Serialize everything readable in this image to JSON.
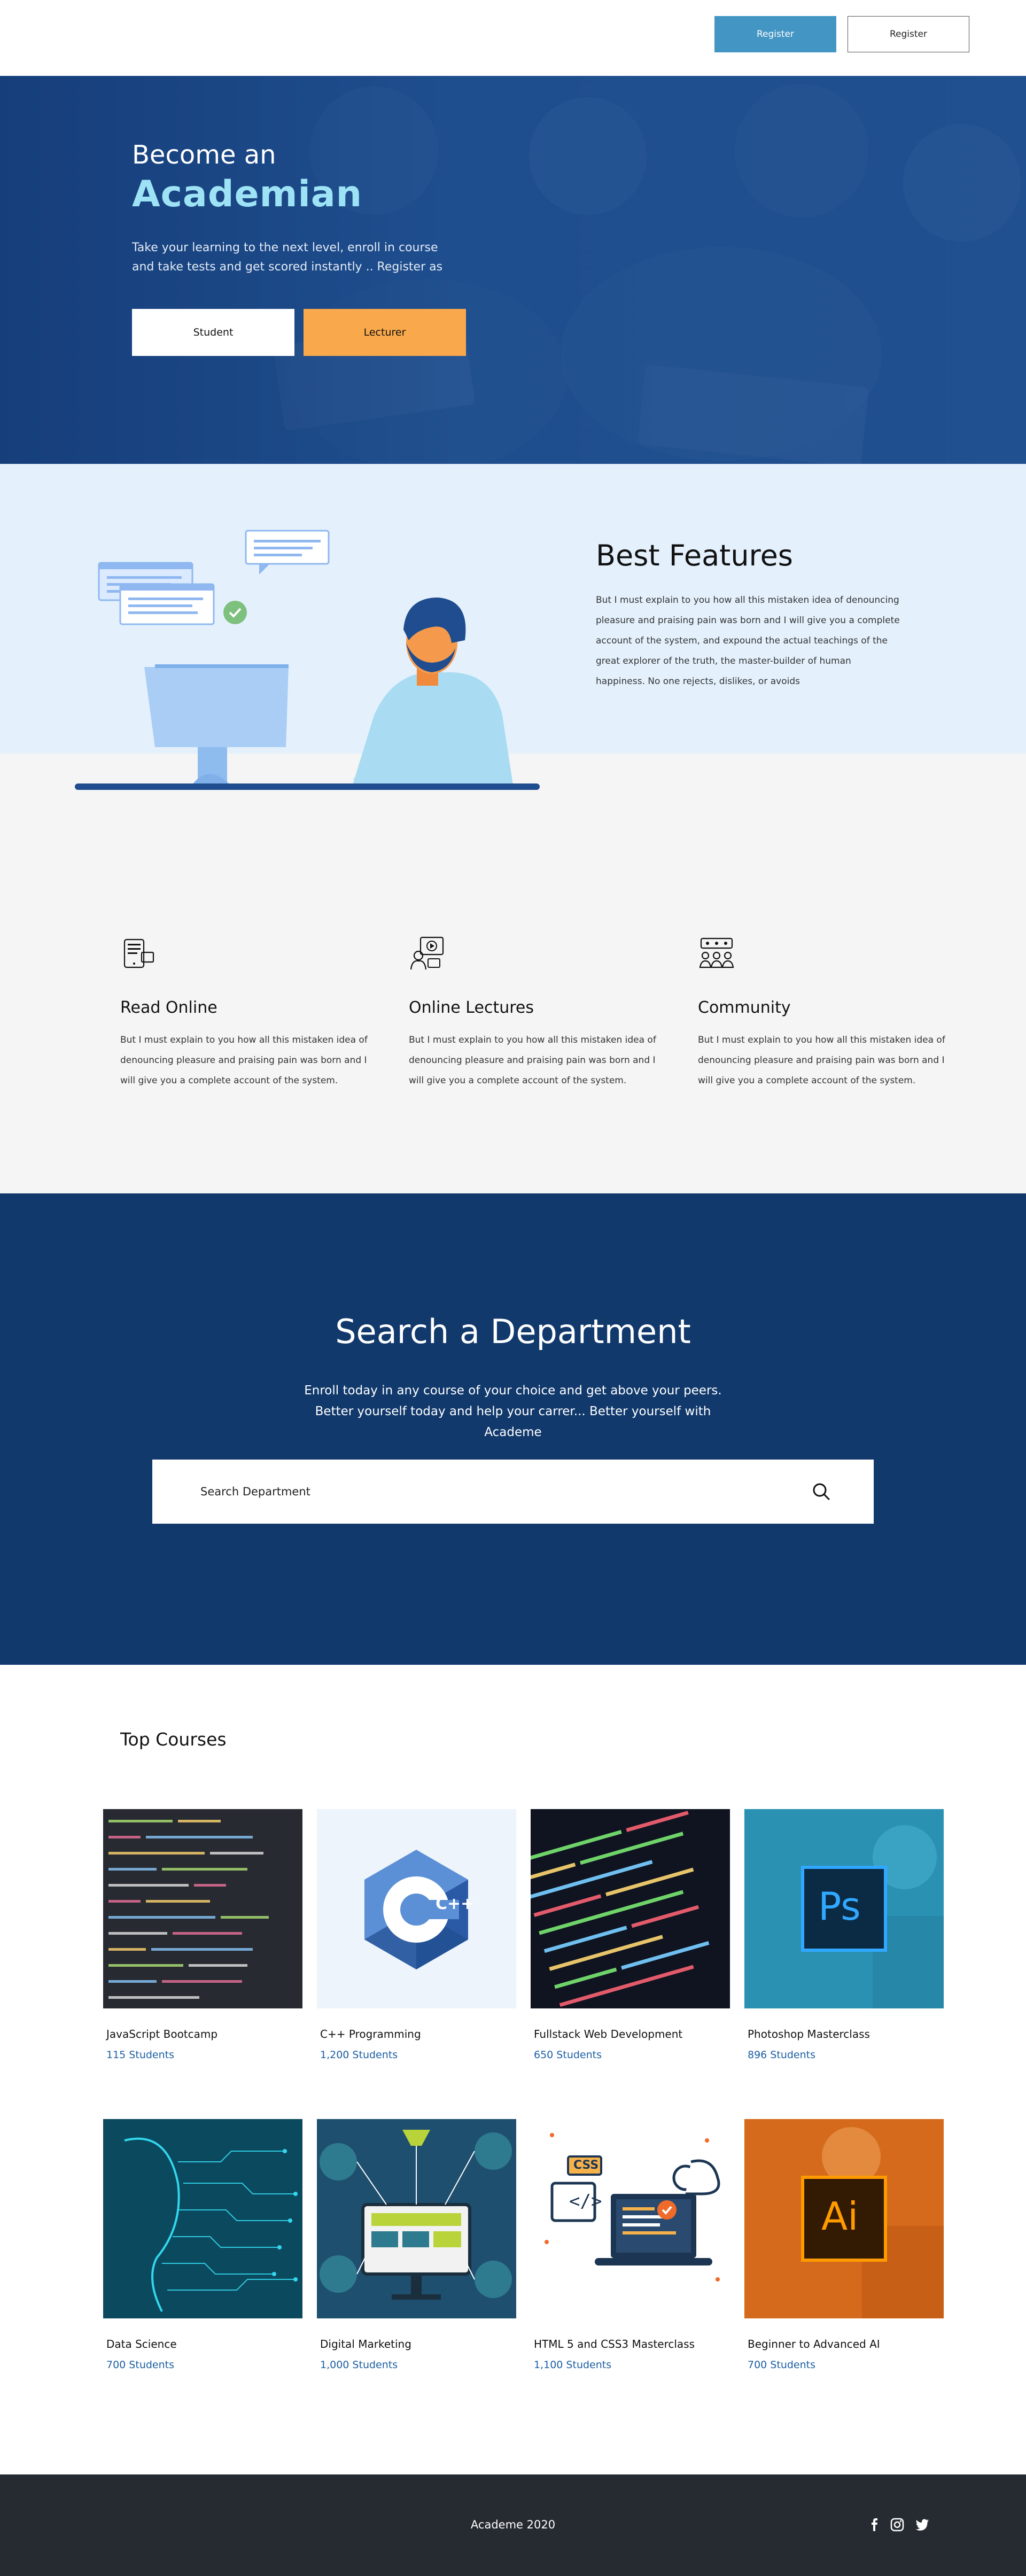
{
  "nav": {
    "register_primary": "Register",
    "register_secondary": "Register"
  },
  "hero": {
    "title_line1": "Become an",
    "title_line2": "Academian",
    "text": "Take your learning to the next level, enroll in course and take tests and get scored instantly .. Register as",
    "student_button": "Student",
    "lecturer_button": "Lecturer"
  },
  "best_features": {
    "title": "Best Features",
    "text": "But I must explain to you how all this mistaken idea of denouncing pleasure and praising pain was born and I will give you a complete account of the system, and expound the actual teachings of the great explorer of the truth, the master-builder of human happiness. No one rejects, dislikes, or avoids"
  },
  "features": [
    {
      "title": "Read Online",
      "icon": "tablet-reading-icon",
      "text": "But I must explain to you how all this mistaken idea of denouncing pleasure and praising pain was born and I will give you a complete account of the system."
    },
    {
      "title": "Online Lectures",
      "icon": "video-lecture-icon",
      "text": "But I must explain to you how all this mistaken idea of denouncing pleasure and praising pain was born and I will give you a complete account of the system."
    },
    {
      "title": "Community",
      "icon": "community-icon",
      "text": "But I must explain to you how all this mistaken idea of denouncing pleasure and praising pain was born and I will give you a complete account of the system."
    }
  ],
  "search": {
    "title": "Search a Department",
    "text": "Enroll today in any course  of your choice and get above your peers. Better yourself today and help your carrer...  Better yourself with Academe",
    "placeholder": "Search Department"
  },
  "courses": {
    "title": "Top Courses",
    "items": [
      {
        "name": "JavaScript Bootcamp",
        "students": "115 Students"
      },
      {
        "name": "C++ Programming",
        "students": "1,200 Students"
      },
      {
        "name": "Fullstack Web Development",
        "students": "650 Students"
      },
      {
        "name": "Photoshop Masterclass",
        "students": "896 Students"
      },
      {
        "name": "Data Science",
        "students": "700 Students"
      },
      {
        "name": "Digital Marketing",
        "students": "1,000 Students"
      },
      {
        "name": "HTML 5 and CSS3 Masterclass",
        "students": "1,100 Students"
      },
      {
        "name": "Beginner to Advanced AI",
        "students": "700 Students"
      }
    ],
    "thumb_labels": {
      "cpp": "C++",
      "ps": "Ps",
      "ai": "Ai",
      "css": "CSS"
    }
  },
  "footer": {
    "text": "Academe 2020",
    "social": [
      "facebook-icon",
      "instagram-icon",
      "twitter-icon"
    ]
  },
  "colors": {
    "primary_blue": "#4396c4",
    "navy": "#11396c",
    "accent_orange": "#f9a94b",
    "link_blue": "#1b5ea3",
    "footer": "#262a31"
  }
}
